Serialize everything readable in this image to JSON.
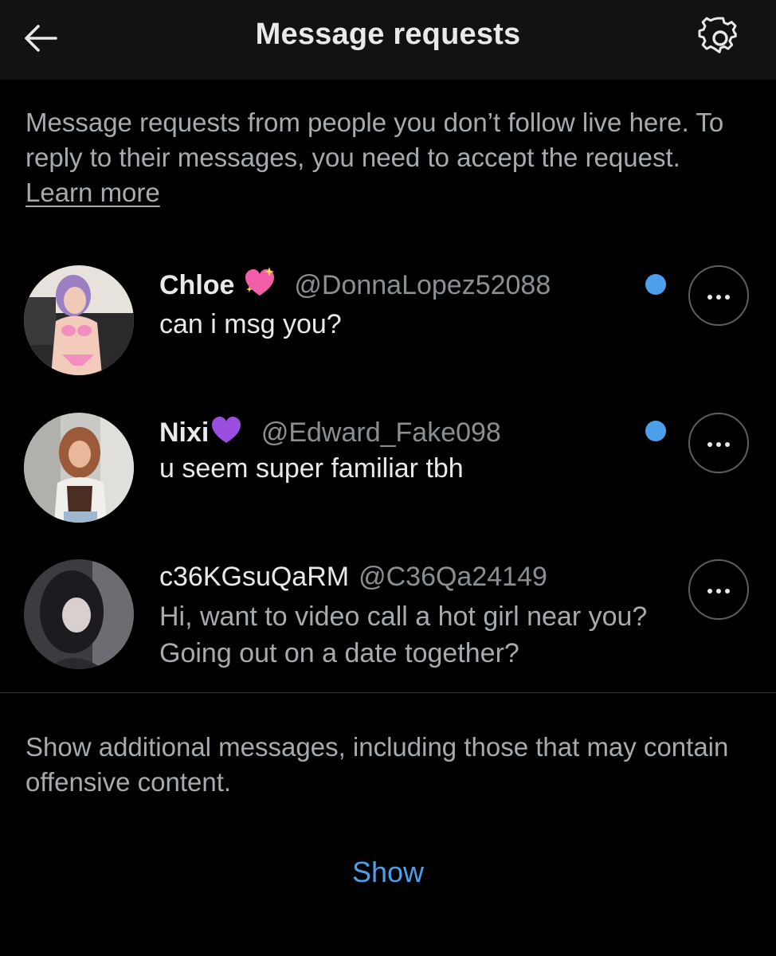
{
  "header": {
    "title": "Message requests",
    "back_icon": "arrow-left-icon",
    "settings_icon": "gear-icon"
  },
  "info": {
    "text": "Message requests from people you don’t follow live here. To reply to their messages, you need to accept the request. ",
    "link_label": "Learn more"
  },
  "requests": [
    {
      "name": "Chloe",
      "emoji": "sparkling-heart",
      "handle": "@DonnaLopez52088",
      "message": "can i msg you?",
      "unread": true,
      "more_icon": "more-horizontal-icon"
    },
    {
      "name": "Nixi",
      "emoji": "purple-heart",
      "handle": "@Edward_Fake098",
      "message": "u seem super familiar tbh",
      "unread": true,
      "more_icon": "more-horizontal-icon"
    },
    {
      "name": "c36KGsuQaRM",
      "handle": "@C36Qa24149",
      "message": "Hi, want to video call a hot girl near you? Going out on a date together?",
      "unread": false,
      "more_icon": "more-horizontal-icon"
    }
  ],
  "filtered": {
    "text": "Show additional messages, including those that may contain offensive content.",
    "show_label": "Show"
  },
  "colors": {
    "background": "#000000",
    "topbar": "#121212",
    "primary_text": "#e7e9ea",
    "secondary_text": "#a6abb0",
    "accent": "#4d9fec"
  }
}
